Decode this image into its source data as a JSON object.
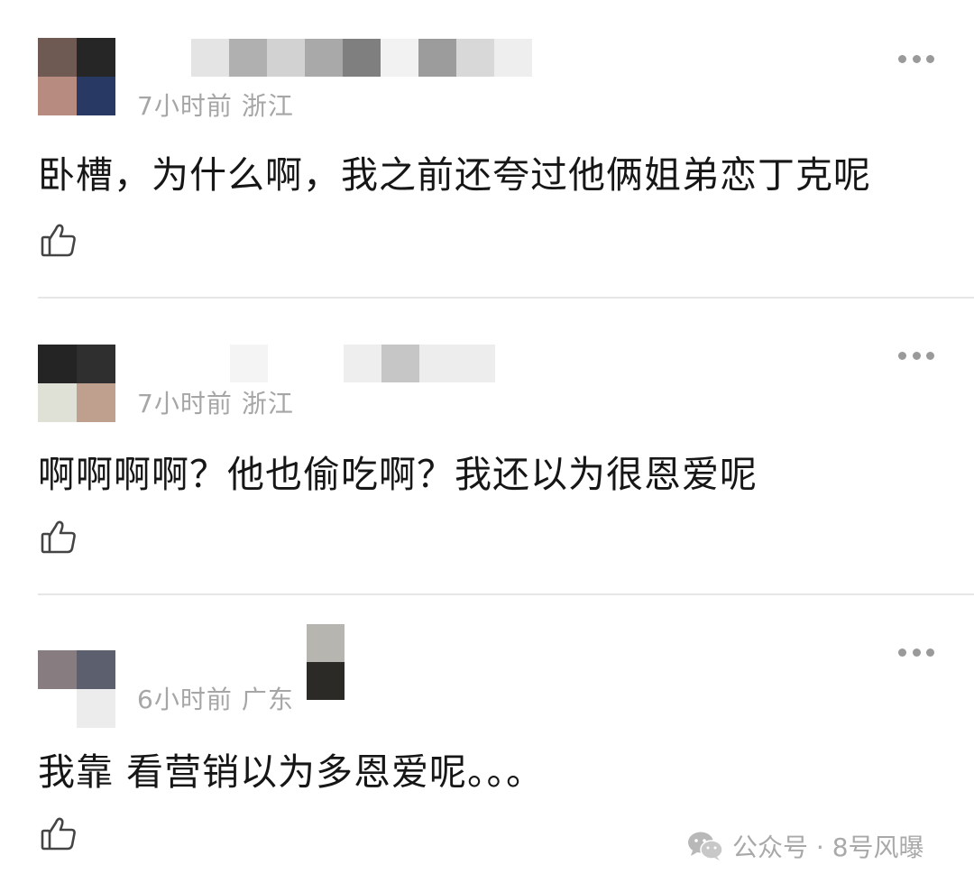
{
  "comments": [
    {
      "time": "7小时前",
      "location": "浙江",
      "text": "卧槽，为什么啊，我之前还夸过他俩姐弟恋丁克呢"
    },
    {
      "time": "7小时前",
      "location": "浙江",
      "text": "啊啊啊啊？他也偷吃啊？我还以为很恩爱呢"
    },
    {
      "time": "6小时前",
      "location": "广东",
      "text": "我靠 看营销以为多恩爱呢。。。"
    }
  ],
  "watermark": {
    "text": "公众号 · 8号风曝"
  },
  "icons": {
    "more": "more-dots-icon",
    "like": "thumbs-up-icon",
    "watermark": "wechat-icon"
  }
}
